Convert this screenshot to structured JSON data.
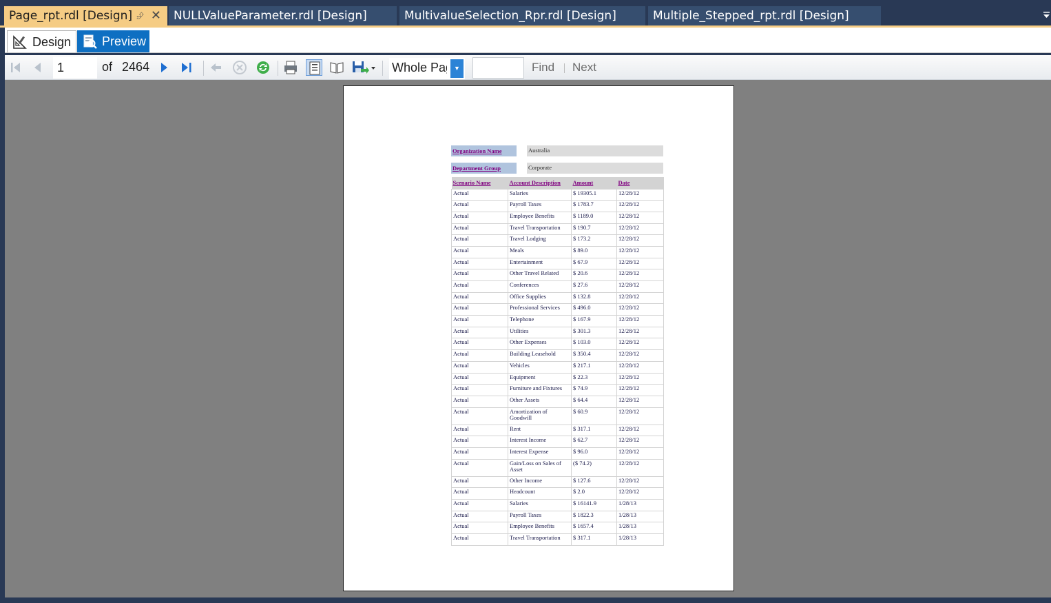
{
  "tabs": [
    {
      "label": "Page_rpt.rdl [Design]",
      "active": true
    },
    {
      "label": "NULLValueParameter.rdl [Design]",
      "active": false
    },
    {
      "label": "MultivalueSelection_Rpr.rdl [Design]",
      "active": false
    },
    {
      "label": "Multiple_Stepped_rpt.rdl [Design]",
      "active": false
    }
  ],
  "view_tabs": {
    "design": "Design",
    "preview": "Preview"
  },
  "toolbar": {
    "page_number": "1",
    "of_label": "of",
    "total_pages": "2464",
    "zoom": "Whole Page",
    "find_placeholder": "",
    "find_label": "Find",
    "next_label": "Next"
  },
  "report": {
    "params": [
      {
        "label": "Organization Name",
        "value": "Australia"
      },
      {
        "label": "Department Group",
        "value": "Corporate"
      }
    ],
    "columns": [
      "Scenario Name",
      "Account Description",
      "Amount",
      "Date"
    ],
    "rows": [
      [
        "Actual",
        "Salaries",
        "$ 19305.1",
        "12/28/12"
      ],
      [
        "Actual",
        "Payroll Taxes",
        "$ 1783.7",
        "12/28/12"
      ],
      [
        "Actual",
        "Employee Benefits",
        "$ 1189.0",
        "12/28/12"
      ],
      [
        "Actual",
        "Travel Transportation",
        "$ 190.7",
        "12/28/12"
      ],
      [
        "Actual",
        "Travel Lodging",
        "$ 173.2",
        "12/28/12"
      ],
      [
        "Actual",
        "Meals",
        "$ 89.0",
        "12/28/12"
      ],
      [
        "Actual",
        "Entertainment",
        "$ 67.9",
        "12/28/12"
      ],
      [
        "Actual",
        "Other Travel Related",
        "$ 20.6",
        "12/28/12"
      ],
      [
        "Actual",
        "Conferences",
        "$ 27.6",
        "12/28/12"
      ],
      [
        "Actual",
        "Office Supplies",
        "$ 132.8",
        "12/28/12"
      ],
      [
        "Actual",
        "Professional Services",
        "$ 496.0",
        "12/28/12"
      ],
      [
        "Actual",
        "Telephone",
        "$ 167.9",
        "12/28/12"
      ],
      [
        "Actual",
        "Utilities",
        "$ 301.3",
        "12/28/12"
      ],
      [
        "Actual",
        "Other Expenses",
        "$ 103.0",
        "12/28/12"
      ],
      [
        "Actual",
        "Building Leasehold",
        "$ 350.4",
        "12/28/12"
      ],
      [
        "Actual",
        "Vehicles",
        "$ 217.1",
        "12/28/12"
      ],
      [
        "Actual",
        "Equipment",
        "$ 22.3",
        "12/28/12"
      ],
      [
        "Actual",
        "Furniture and Fixtures",
        "$ 74.9",
        "12/28/12"
      ],
      [
        "Actual",
        "Other Assets",
        "$ 64.4",
        "12/28/12"
      ],
      [
        "Actual",
        "Amortization of Goodwill",
        "$ 60.9",
        "12/28/12"
      ],
      [
        "Actual",
        "Rent",
        "$ 317.1",
        "12/28/12"
      ],
      [
        "Actual",
        "Interest Income",
        "$ 62.7",
        "12/28/12"
      ],
      [
        "Actual",
        "Interest Expense",
        "$ 96.0",
        "12/28/12"
      ],
      [
        "Actual",
        "Gain/Loss on Sales of Asset",
        "($ 74.2)",
        "12/28/12"
      ],
      [
        "Actual",
        "Other Income",
        "$ 127.6",
        "12/28/12"
      ],
      [
        "Actual",
        "Headcount",
        "$ 2.0",
        "12/28/12"
      ],
      [
        "Actual",
        "Salaries",
        "$ 16141.9",
        "1/28/13"
      ],
      [
        "Actual",
        "Payroll Taxes",
        "$ 1822.3",
        "1/28/13"
      ],
      [
        "Actual",
        "Employee Benefits",
        "$ 1657.4",
        "1/28/13"
      ],
      [
        "Actual",
        "Travel Transportation",
        "$ 317.1",
        "1/28/13"
      ]
    ]
  }
}
